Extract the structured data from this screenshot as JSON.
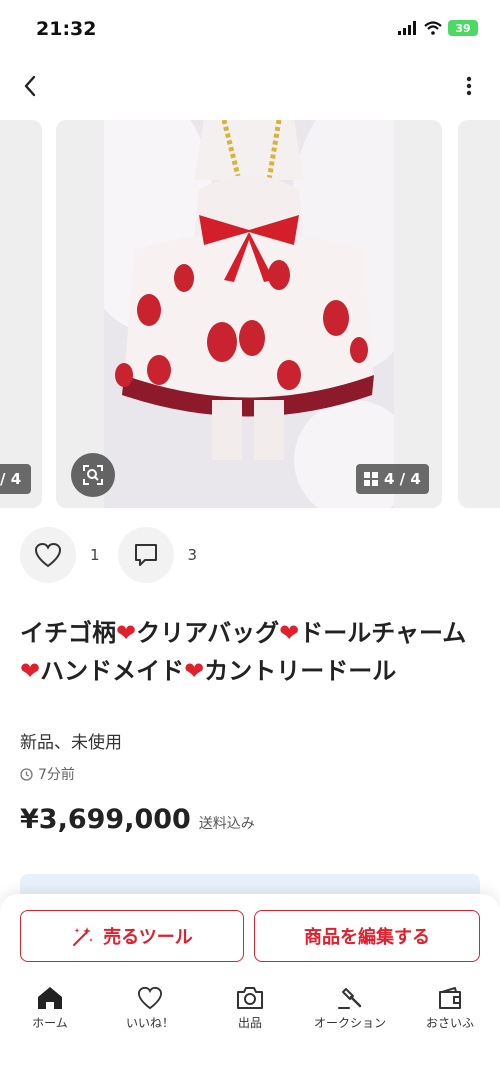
{
  "status_bar": {
    "time": "21:32",
    "battery": "39"
  },
  "carousel": {
    "prev_counter": "/ 4",
    "counter": "4 / 4"
  },
  "actions": {
    "like_count": "1",
    "comment_count": "3"
  },
  "item": {
    "title_parts": [
      "イチゴ柄",
      "クリアバッグ",
      "ドールチャーム",
      "ハンドメイド",
      "カントリードール"
    ],
    "condition": "新品、未使用",
    "posted": "7分前",
    "price": "¥3,699,000",
    "shipping_note": "送料込み"
  },
  "buttons": {
    "sell_tool": "売るツール",
    "edit_item": "商品を編集する"
  },
  "tabs": [
    {
      "label": "ホーム",
      "icon": "home-icon"
    },
    {
      "label": "いいね！",
      "icon": "heart-icon"
    },
    {
      "label": "出品",
      "icon": "camera-icon"
    },
    {
      "label": "オークション",
      "icon": "gavel-icon"
    },
    {
      "label": "おさいふ",
      "icon": "wallet-icon"
    }
  ],
  "colors": {
    "accent": "#e0202d",
    "status_green": "#4cd964"
  }
}
